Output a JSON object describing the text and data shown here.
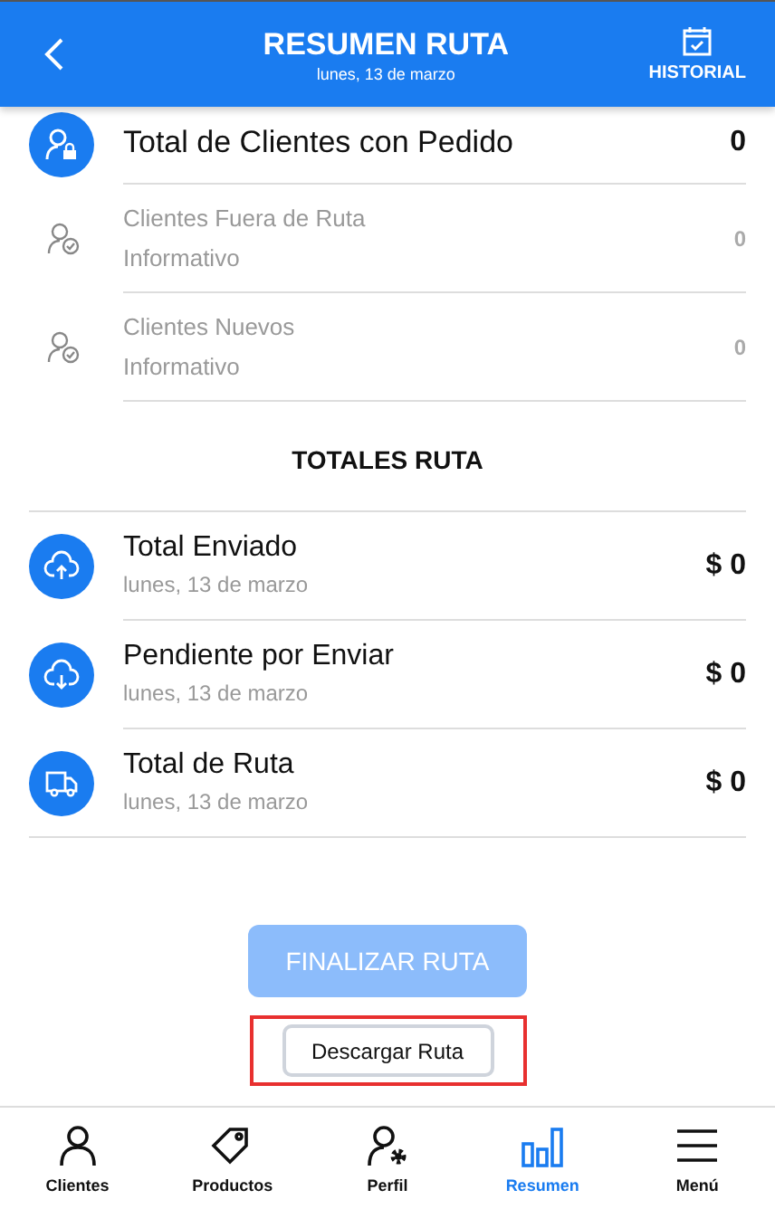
{
  "header": {
    "title": "RESUMEN RUTA",
    "subtitle": "lunes, 13 de marzo",
    "action": "HISTORIAL"
  },
  "client_rows": [
    {
      "kind": "primary",
      "label": "Total de Clientes con Pedido",
      "value": "0"
    },
    {
      "kind": "info",
      "label": "Clientes Fuera de Ruta",
      "sublabel": "Informativo",
      "value": "0"
    },
    {
      "kind": "info",
      "label": "Clientes Nuevos",
      "sublabel": "Informativo",
      "value": "0"
    }
  ],
  "totals": {
    "title": "TOTALES RUTA",
    "rows": [
      {
        "label": "Total Enviado",
        "date": "lunes, 13 de marzo",
        "value": "$ 0"
      },
      {
        "label": "Pendiente por Enviar",
        "date": "lunes, 13 de marzo",
        "value": "$ 0"
      },
      {
        "label": "Total de Ruta",
        "date": "lunes, 13 de marzo",
        "value": "$ 0"
      }
    ]
  },
  "finish_button": {
    "label": "FINALIZAR RUTA",
    "disabled": true
  },
  "download_button": {
    "label": "Descargar Ruta",
    "highlighted": true
  },
  "nav": [
    {
      "label": "Clientes",
      "selected": false
    },
    {
      "label": "Productos",
      "selected": false
    },
    {
      "label": "Perfil",
      "selected": false
    },
    {
      "label": "Resumen",
      "selected": true
    },
    {
      "label": "Menú",
      "selected": false
    }
  ]
}
